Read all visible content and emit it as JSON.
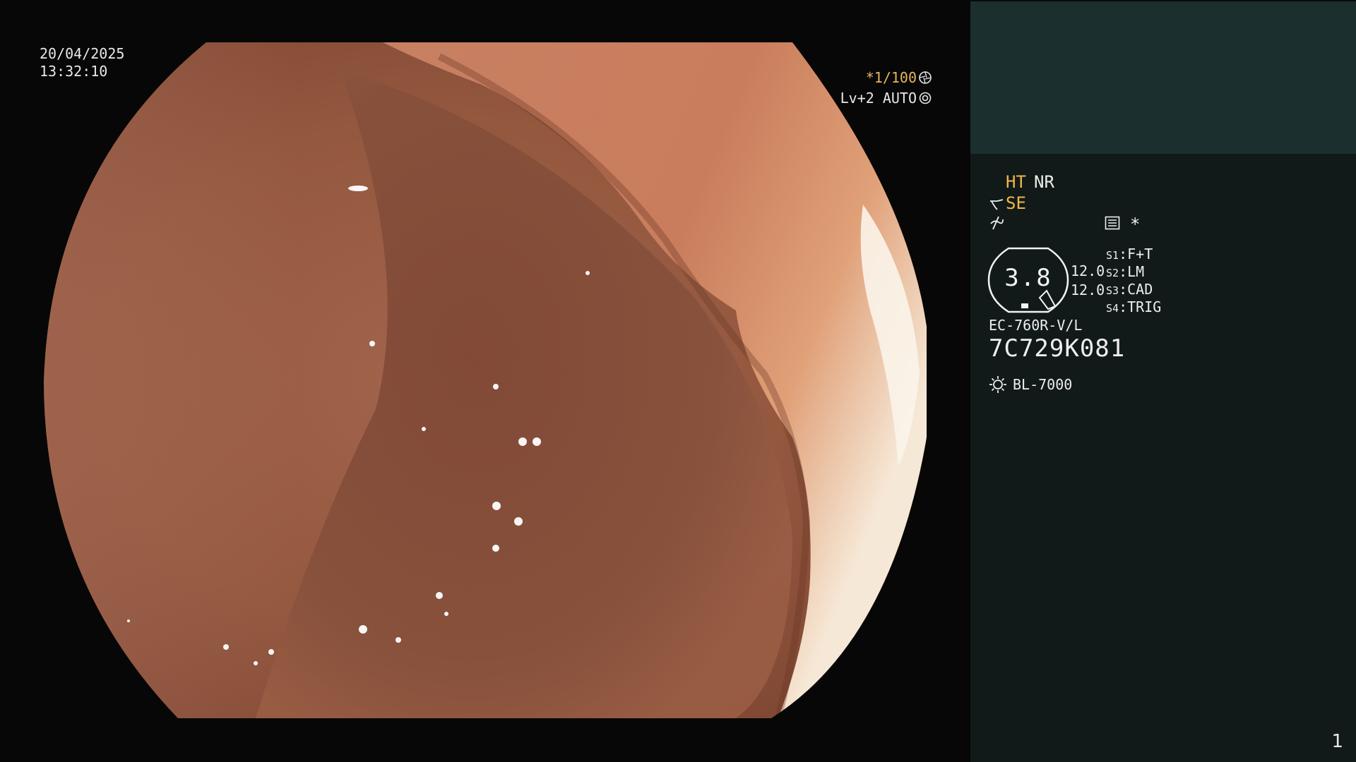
{
  "overlay": {
    "date": "20/04/2025",
    "time": "13:32:10",
    "shutter": "*1/100",
    "level": "Lv+2 AUTO"
  },
  "panel": {
    "ht_label": "HT",
    "nr_label": "NR",
    "se_label": "SE",
    "star_label": "*",
    "gauge_value": "3.8",
    "gain_1": "12.0",
    "gain_2": "12.0",
    "switches": [
      {
        "key": "S1",
        "value": "F+T"
      },
      {
        "key": "S2",
        "value": "LM"
      },
      {
        "key": "S3",
        "value": "CAD"
      },
      {
        "key": "S4",
        "value": "TRIG"
      }
    ],
    "scope_model": "EC-760R-V/L",
    "scope_serial": "7C729K081",
    "light_source": "BL-7000"
  },
  "page_number": "1",
  "colors": {
    "amber": "#f0b54a",
    "panel_bg": "#111a18",
    "panel_top_bg": "#1b2f2e",
    "tissue": "#9a6048"
  },
  "icons": {
    "shutter_icon": "aperture-icon",
    "level_icon": "gear-icon",
    "se_icon": "scope-tip-icon",
    "enhance_icon": "slash-curve-icon",
    "list_icon": "list-icon",
    "light_icon": "sun-icon"
  }
}
